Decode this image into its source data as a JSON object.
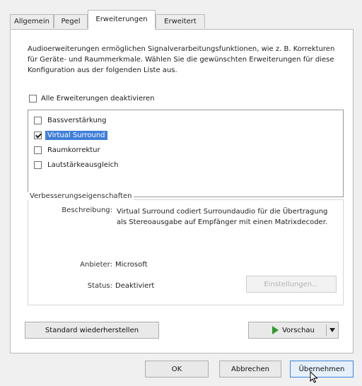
{
  "tabs": [
    {
      "label": "Allgemein"
    },
    {
      "label": "Pegel"
    },
    {
      "label": "Erweiterungen"
    },
    {
      "label": "Erweitert"
    }
  ],
  "intro_text": "Audioerweiterungen ermöglichen Signalverarbeitungsfunktionen, wie z. B. Korrekturen für Geräte- und Raummerkmale. Wählen Sie die gewünschten Erweiterungen für diese Konfiguration aus der folgenden Liste aus.",
  "disable_all": {
    "label": "Alle Erweiterungen deaktivieren",
    "checked": false
  },
  "enhancements": [
    {
      "label": "Bassverstärkung",
      "checked": false,
      "selected": false
    },
    {
      "label": "Virtual Surround",
      "checked": true,
      "selected": true
    },
    {
      "label": "Raumkorrektur",
      "checked": false,
      "selected": false
    },
    {
      "label": "Lautstärkeausgleich",
      "checked": false,
      "selected": false
    }
  ],
  "properties": {
    "title": "Verbesserungseigenschaften",
    "description_label": "Beschreibung:",
    "description": "Virtual Surround codiert Surroundaudio für die Übertragung als Stereoausgabe auf Empfänger mit einen Matrixdecoder.",
    "provider_label": "Anbieter:",
    "provider": "Microsoft",
    "status_label": "Status:",
    "status": "Deaktiviert",
    "settings_button": "Einstellungen..."
  },
  "restore_button": "Standard wiederherstellen",
  "preview_button": "Vorschau",
  "footer": {
    "ok": "OK",
    "cancel": "Abbrechen",
    "apply": "Übernehmen"
  }
}
